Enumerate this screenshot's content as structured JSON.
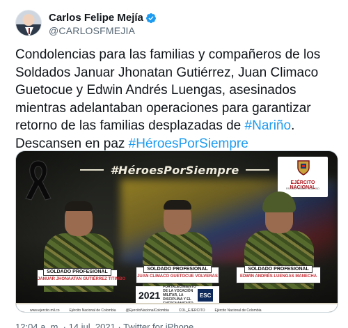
{
  "author": {
    "display_name": "Carlos Felipe Mejía",
    "handle": "@CARLOSFMEJIA",
    "verified": true,
    "avatar_icon": "person-avatar"
  },
  "tweet": {
    "text_line1": "Condolencias para las familias y compañeros de los",
    "text_line2": "Soldados Januar Jhonatan Gutiérrez, Juan Climaco",
    "text_line3": "Guetocue y Edwin Andrés Luengas, asesinados",
    "text_line4": "mientras adelantaban operaciones para garantizar",
    "text_line5_pre": "retorno de las familias desplazadas de ",
    "text_line5_link": "#Nariño",
    "text_line5_post": ".",
    "text_line6_pre": "Descansen en paz ",
    "text_line6_link": "#HéroesPorSiempre",
    "link_color": "#1d9bf0"
  },
  "media": {
    "hashtag": "#HéroesPorSiempre",
    "army_title": "EJÉRCITO NACIONAL",
    "army_subtitle": "PATRIA HONOR LEALTAD",
    "soldiers": [
      {
        "rank": "SOLDADO PROFESIONAL",
        "name": "JANUAR JHONAATAN GUTIÉRREZ TITIMBO"
      },
      {
        "rank": "SOLDADO PROFESIONAL",
        "name": "JUAN CLIMACO GUETOCUE VOLVERAS"
      },
      {
        "rank": "SOLDADO PROFESIONAL",
        "name": "EDWIN ANDRÉS LUENGAS MANECHA"
      }
    ],
    "year": "2021",
    "year_caption": "FORTALECIMIENTO DE LA VOCACIÓN MILITAR, LA DISCIPLINA Y EL ENTRENAMIENTO",
    "esc_badge": "ESC",
    "footer_links": [
      "www.ejercito.mil.co",
      "Ejército Nacional de Colombia",
      "@EjercitoNacionalColombia",
      "COL_EJERCITO",
      "Ejército Nacional de Colombia"
    ]
  },
  "meta": {
    "timestamp": "12:04 a. m. · 14 jul. 2021 · Twitter for iPhone"
  }
}
